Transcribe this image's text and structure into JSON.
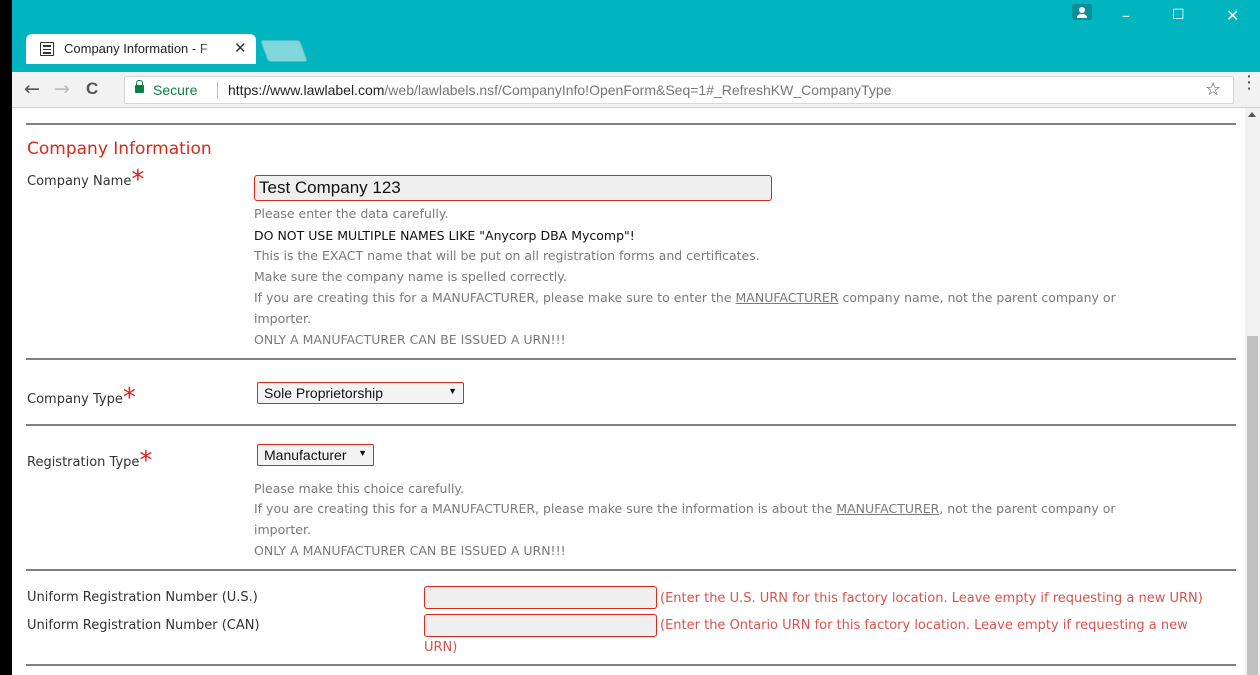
{
  "browser": {
    "tab_title": "Company Information - F",
    "tab_close": "✕",
    "secure_label": "Secure",
    "url_host": "https://www.lawlabel.com",
    "url_path": "/web/lawlabels.nsf/CompanyInfo!OpenForm&Seq=1#_RefreshKW_CompanyType",
    "minimize": "–",
    "maximize": "☐",
    "close": "✕",
    "back": "←",
    "forward": "→",
    "reload": "C",
    "bookmark": "☆",
    "menu": "⋮"
  },
  "form": {
    "section_title": "Company Information",
    "company_name": {
      "label": "Company Name",
      "value": "Test Company 123",
      "notes": [
        "Please enter the data carefully.",
        "DO NOT USE MULTIPLE NAMES LIKE \"Anycorp DBA Mycomp\"!",
        "This is the EXACT name that will be put on all registration forms and certificates.",
        "Make sure the company name is spelled correctly."
      ],
      "note_mfr_prefix": "If you are creating this for a MANUFACTURER, please make sure to enter the ",
      "note_mfr_link": "MANUFACTURER",
      "note_mfr_suffix": " company name, not the parent company or",
      "note_mfr_cont": "importer.",
      "note_urn": "ONLY A MANUFACTURER CAN BE ISSUED A URN!!!"
    },
    "company_type": {
      "label": "Company Type",
      "selected": "Sole Proprietorship"
    },
    "registration_type": {
      "label": "Registration Type",
      "selected": "Manufacturer",
      "note_1": "Please make this choice carefully.",
      "note_2_prefix": "If you are creating this for a MANUFACTURER, please make sure the information is about the ",
      "note_2_link": "MANUFACTURER",
      "note_2_suffix": ", not the parent company or",
      "note_2_cont": "importer.",
      "note_urn": "ONLY A MANUFACTURER CAN BE ISSUED A URN!!!"
    },
    "urn_us": {
      "label": "Uniform Registration Number (U.S.)",
      "value": "",
      "hint": "(Enter the U.S. URN for this factory location. Leave empty if requesting a new URN)"
    },
    "urn_can": {
      "label": "Uniform Registration Number (CAN)",
      "value": "",
      "hint": "(Enter the Ontario URN for this factory location. Leave empty if requesting a new",
      "hint_cont": "URN)"
    },
    "required_mark": "*"
  },
  "colors": {
    "titlebar": "#00b5c0",
    "accent_red": "#d62a1a",
    "secure_green": "#0b8043"
  }
}
